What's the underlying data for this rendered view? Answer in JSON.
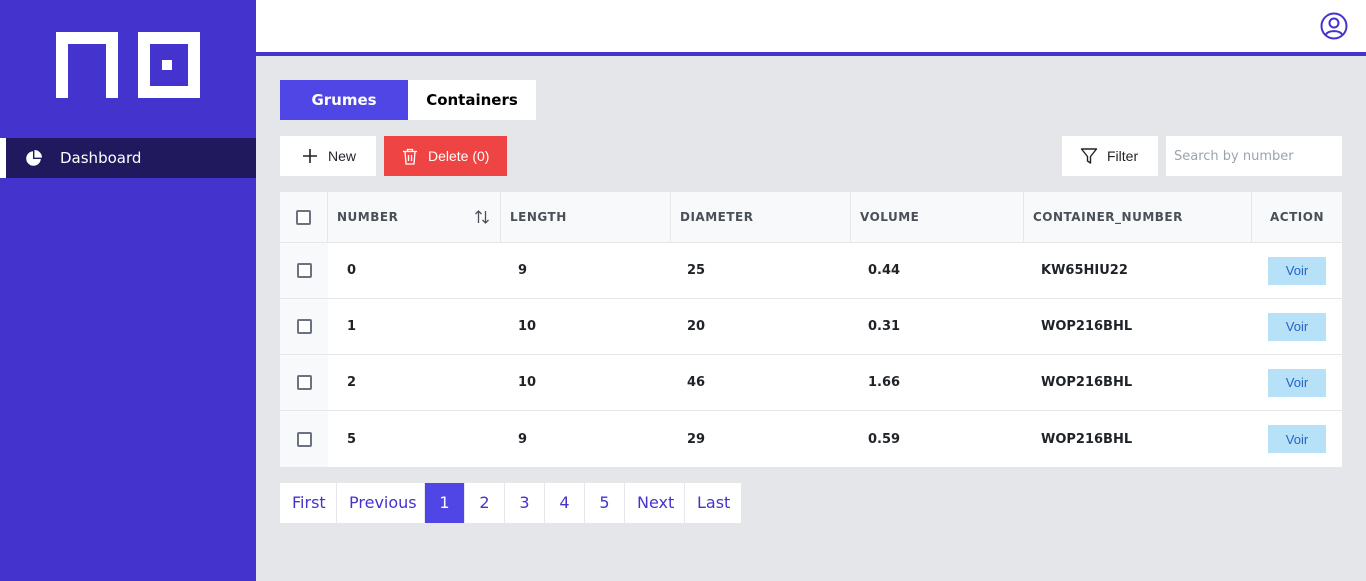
{
  "sidebar": {
    "items": [
      {
        "label": "Dashboard",
        "icon": "pie-chart-icon"
      }
    ]
  },
  "tabs": [
    {
      "label": "Grumes",
      "active": true
    },
    {
      "label": "Containers",
      "active": false
    }
  ],
  "toolbar": {
    "new_label": "New",
    "delete_label": "Delete (0)",
    "filter_label": "Filter",
    "search_placeholder": "Search by number"
  },
  "table": {
    "columns": [
      "NUMBER",
      "LENGTH",
      "DIAMETER",
      "VOLUME",
      "CONTAINER_NUMBER",
      "ACTION"
    ],
    "rows": [
      {
        "number": "0",
        "length": "9",
        "diameter": "25",
        "volume": "0.44",
        "container_number": "KW65HIU22",
        "action": "Voir"
      },
      {
        "number": "1",
        "length": "10",
        "diameter": "20",
        "volume": "0.31",
        "container_number": "WOP216BHL",
        "action": "Voir"
      },
      {
        "number": "2",
        "length": "10",
        "diameter": "46",
        "volume": "1.66",
        "container_number": "WOP216BHL",
        "action": "Voir"
      },
      {
        "number": "5",
        "length": "9",
        "diameter": "29",
        "volume": "0.59",
        "container_number": "WOP216BHL",
        "action": "Voir"
      }
    ]
  },
  "pagination": {
    "first": "First",
    "previous": "Previous",
    "pages": [
      "1",
      "2",
      "3",
      "4",
      "5"
    ],
    "current": "1",
    "next": "Next",
    "last": "Last"
  },
  "colors": {
    "brand": "#4433cc",
    "active_tab": "#4f46e5",
    "danger": "#ef4444",
    "action_button": "#b6e1f6"
  }
}
